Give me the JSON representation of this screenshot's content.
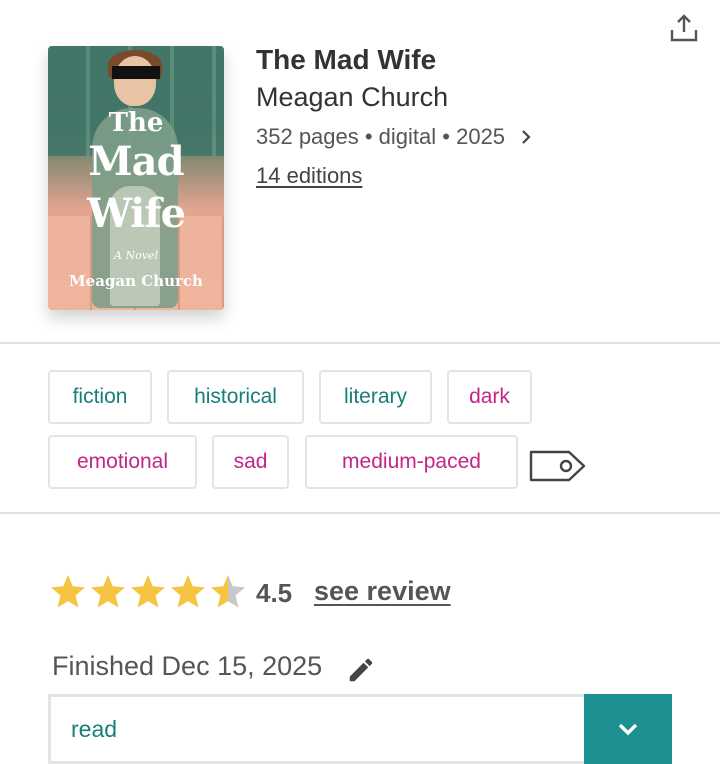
{
  "book": {
    "title": "The Mad Wife",
    "author": "Meagan Church",
    "meta": "352 pages • digital • 2025",
    "editions_link": "14 editions",
    "cover": {
      "title_line1": "The",
      "title_line2": "Mad",
      "title_line3": "Wife",
      "subtitle": "A Novel",
      "author": "Meagan Church"
    }
  },
  "tags": [
    {
      "label": "fiction",
      "color": "#167f79"
    },
    {
      "label": "historical",
      "color": "#167f79"
    },
    {
      "label": "literary",
      "color": "#167f79"
    },
    {
      "label": "dark",
      "color": "#c42585"
    },
    {
      "label": "emotional",
      "color": "#c42585"
    },
    {
      "label": "sad",
      "color": "#c42585"
    },
    {
      "label": "medium-paced",
      "color": "#c42585"
    }
  ],
  "rating": {
    "value": 4.5,
    "value_label": "4.5",
    "max": 5,
    "see_review_label": "see review",
    "star_color": "#f5c542",
    "empty_color": "#c8c8c8"
  },
  "finished": {
    "label": "Finished Dec 15, 2025"
  },
  "status": {
    "value": "read",
    "accent": "#1d9192"
  },
  "icons": {
    "share": "share-upload-icon",
    "chevron": "chevron-right-icon",
    "tag": "tag-icon",
    "edit": "pencil-icon",
    "dropdown": "chevron-down-icon"
  }
}
